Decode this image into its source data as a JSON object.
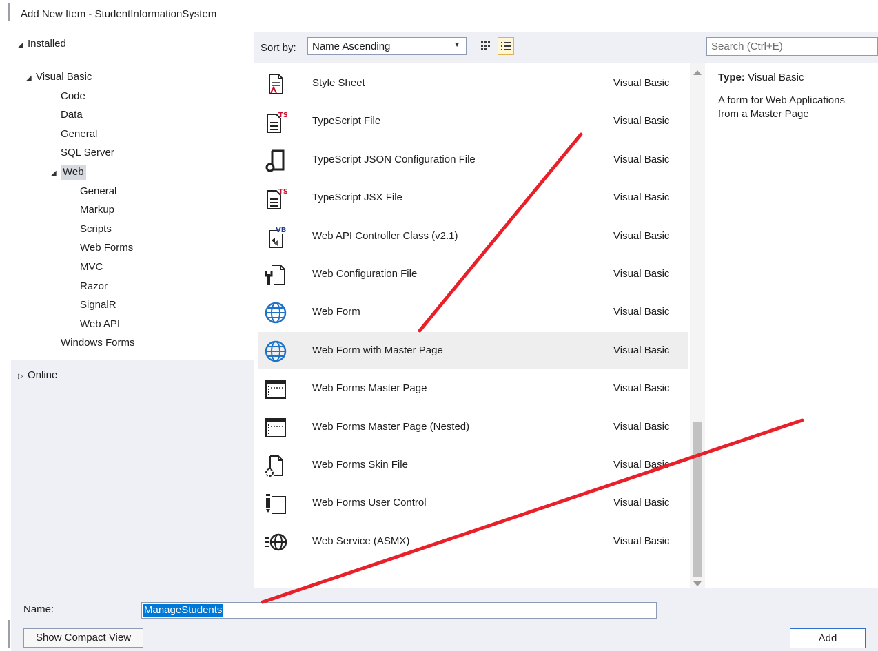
{
  "window": {
    "title": "Add New Item - StudentInformationSystem"
  },
  "tree": {
    "installed_label": "Installed",
    "online_label": "Online",
    "items": [
      {
        "label": "Visual Basic",
        "level": 0,
        "expanded": true
      },
      {
        "label": "Code",
        "level": 1
      },
      {
        "label": "Data",
        "level": 1
      },
      {
        "label": "General",
        "level": 1
      },
      {
        "label": "SQL Server",
        "level": 1
      },
      {
        "label": "Web",
        "level": 1,
        "expanded": true,
        "selected": true
      },
      {
        "label": "General",
        "level": 2
      },
      {
        "label": "Markup",
        "level": 2
      },
      {
        "label": "Scripts",
        "level": 2
      },
      {
        "label": "Web Forms",
        "level": 2
      },
      {
        "label": "MVC",
        "level": 2
      },
      {
        "label": "Razor",
        "level": 2
      },
      {
        "label": "SignalR",
        "level": 2
      },
      {
        "label": "Web API",
        "level": 2
      },
      {
        "label": "Windows Forms",
        "level": 1
      }
    ]
  },
  "sort": {
    "label": "Sort by:",
    "value": "Name Ascending"
  },
  "search": {
    "placeholder": "Search (Ctrl+E)"
  },
  "items": [
    {
      "name": "Style Sheet",
      "lang": "Visual Basic",
      "icon": "stylesheet-file-icon"
    },
    {
      "name": "TypeScript File",
      "lang": "Visual Basic",
      "icon": "typescript-file-icon",
      "badge": "TS"
    },
    {
      "name": "TypeScript JSON Configuration File",
      "lang": "Visual Basic",
      "icon": "json-config-file-icon"
    },
    {
      "name": "TypeScript JSX File",
      "lang": "Visual Basic",
      "icon": "typescript-jsx-file-icon",
      "badge": "TS"
    },
    {
      "name": "Web API Controller Class (v2.1)",
      "lang": "Visual Basic",
      "icon": "webapi-controller-icon",
      "badge": "VB"
    },
    {
      "name": "Web Configuration File",
      "lang": "Visual Basic",
      "icon": "web-config-file-icon"
    },
    {
      "name": "Web Form",
      "lang": "Visual Basic",
      "icon": "globe-icon"
    },
    {
      "name": "Web Form with Master Page",
      "lang": "Visual Basic",
      "icon": "globe-icon",
      "selected": true
    },
    {
      "name": "Web Forms Master Page",
      "lang": "Visual Basic",
      "icon": "master-page-icon"
    },
    {
      "name": "Web Forms Master Page (Nested)",
      "lang": "Visual Basic",
      "icon": "master-page-icon"
    },
    {
      "name": "Web Forms Skin File",
      "lang": "Visual Basic",
      "icon": "skin-file-icon"
    },
    {
      "name": "Web Forms User Control",
      "lang": "Visual Basic",
      "icon": "user-control-icon"
    },
    {
      "name": "Web Service (ASMX)",
      "lang": "Visual Basic",
      "icon": "web-service-icon"
    }
  ],
  "details": {
    "type_label": "Type:",
    "type_value": "Visual Basic",
    "description_line1": "A form for Web Applications",
    "description_line2": "from a Master Page"
  },
  "bottom": {
    "name_label": "Name:",
    "name_value": "ManageStudents",
    "compact_view_label": "Show Compact View",
    "add_label": "Add"
  },
  "colors": {
    "accent_blue": "#0078d7",
    "panel_bg": "#eef0f5",
    "annotation_red": "#e8202a",
    "globe_blue": "#1e73c8"
  }
}
